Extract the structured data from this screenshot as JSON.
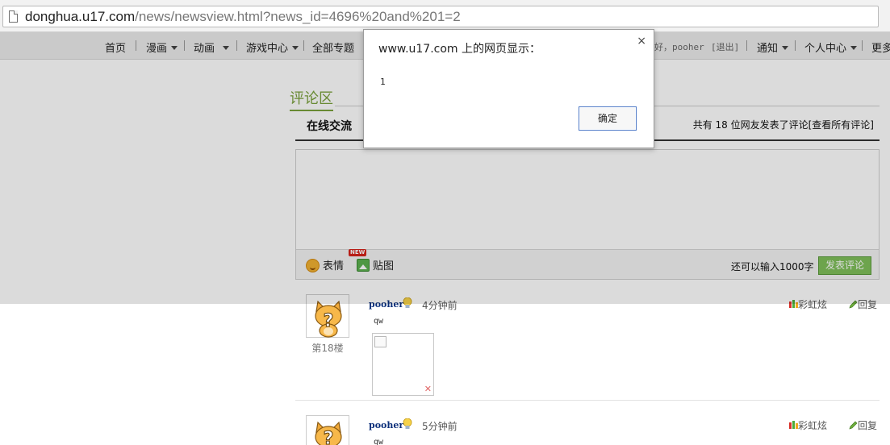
{
  "browser": {
    "url_host": "donghua.u17.com",
    "url_path": "/news/newsview.html?news_id=4696%20and%201=2"
  },
  "nav": {
    "items": [
      {
        "label": "首页",
        "dropdown": false
      },
      {
        "label": "漫画",
        "dropdown": true
      },
      {
        "label": "动画",
        "dropdown": true
      },
      {
        "label": "游戏中心",
        "dropdown": true
      },
      {
        "label": "全部专题",
        "dropdown": false
      }
    ],
    "user_greeting": "好，pooher",
    "logout": "[退出]",
    "notify": "通知",
    "personal_center": "个人中心",
    "more": "更多"
  },
  "comments_section": {
    "title": "评论区",
    "tab_online": "在线交流",
    "count_prefix": "共有 18 位网友发表了评论",
    "view_all": "[查看所有评论]",
    "emoji_label": "表情",
    "new_badge": "NEW",
    "image_label": "贴图",
    "remaining_text": "还可以输入1000字",
    "submit_label": "发表评论"
  },
  "comments": [
    {
      "floor": "第18楼",
      "user": "pooher",
      "time": "4分钟前",
      "text": "qw",
      "rainbow": "彩虹炫",
      "reply": "回复"
    },
    {
      "floor": "",
      "user": "pooher",
      "time": "5分钟前",
      "text": "qw",
      "rainbow": "彩虹炫",
      "reply": "回复"
    }
  ],
  "dialog": {
    "title": "www.u17.com 上的网页显示：",
    "message": "1",
    "ok_label": "确定",
    "close_glyph": "×"
  }
}
